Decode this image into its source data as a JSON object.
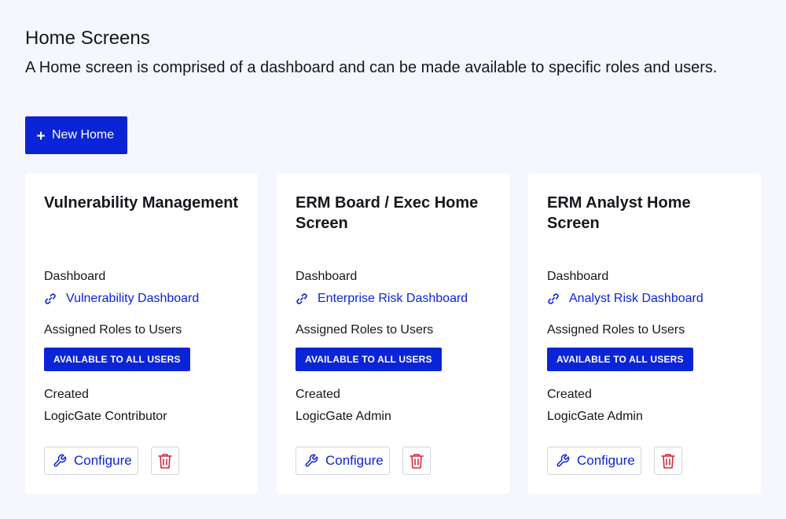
{
  "header": {
    "title": "Home Screens",
    "description": "A Home screen is comprised of a dashboard and can be made available to specific roles and users."
  },
  "toolbar": {
    "new_button_label": "New Home",
    "new_button_icon": "plus-icon"
  },
  "labels": {
    "dashboard": "Dashboard",
    "assigned_roles": "Assigned Roles to Users",
    "created": "Created",
    "configure": "Configure"
  },
  "cards": [
    {
      "title": "Vulnerability Management",
      "dashboard_link": "Vulnerability Dashboard",
      "availability_badge": "AVAILABLE TO ALL USERS",
      "created_by": "LogicGate Contributor"
    },
    {
      "title": "ERM Board / Exec Home Screen",
      "dashboard_link": "Enterprise Risk Dashboard",
      "availability_badge": "AVAILABLE TO ALL USERS",
      "created_by": "LogicGate Admin"
    },
    {
      "title": "ERM Analyst Home Screen",
      "dashboard_link": "Analyst Risk Dashboard",
      "availability_badge": "AVAILABLE TO ALL USERS",
      "created_by": "LogicGate Admin"
    }
  ],
  "colors": {
    "background": "#f6f7fd",
    "primary": "#0b24d6",
    "card": "#ffffff",
    "danger": "#d42a3c"
  },
  "icons": {
    "link": "link-icon",
    "configure": "wrench-icon",
    "delete": "trash-icon"
  }
}
